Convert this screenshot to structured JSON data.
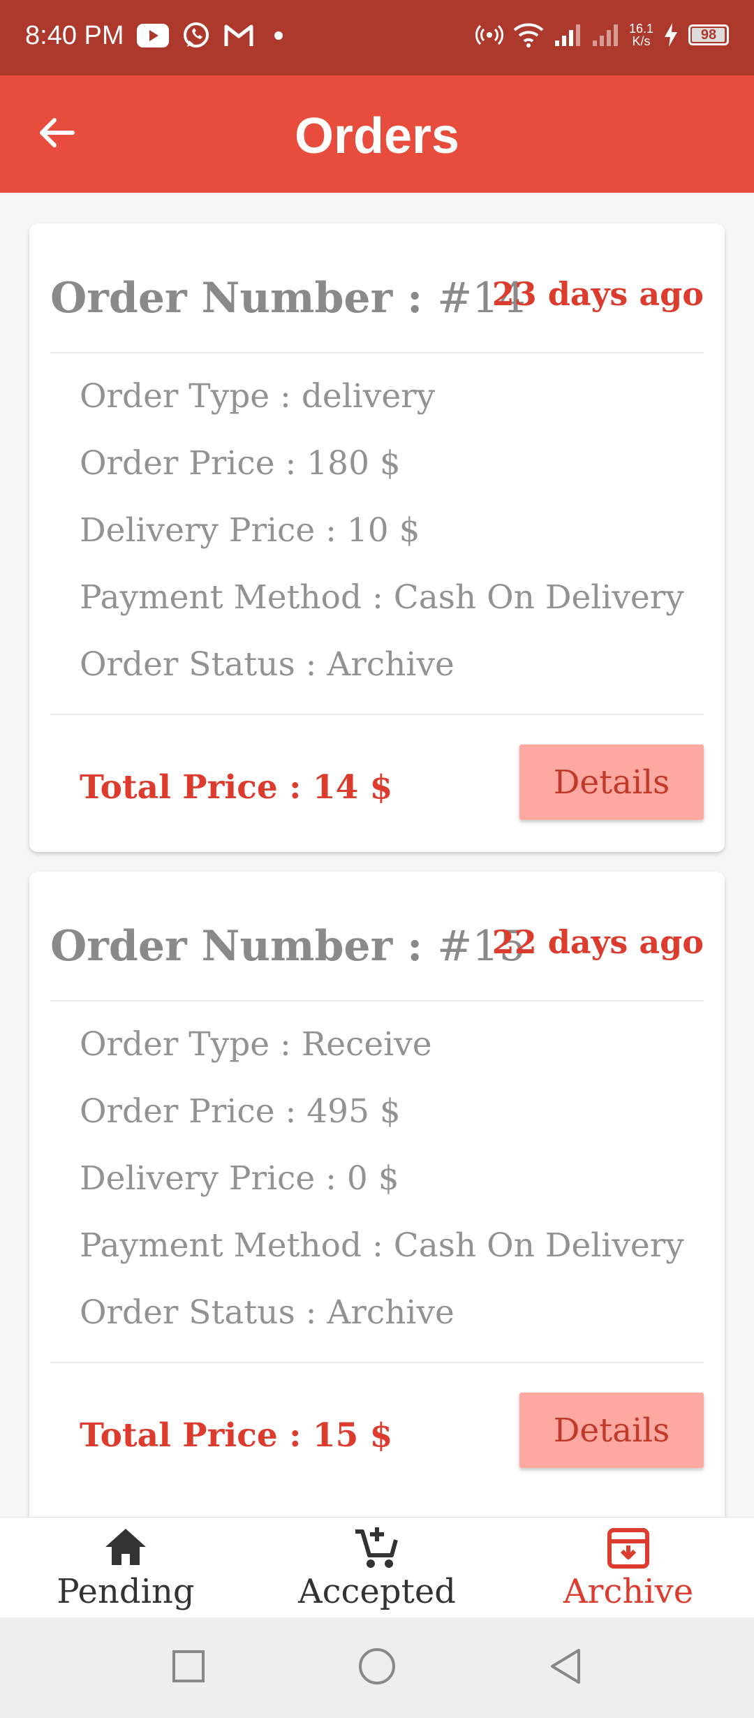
{
  "status_bar": {
    "time": "8:40 PM",
    "net_speed_value": "16.1",
    "net_speed_unit": "K/s",
    "battery": "98",
    "battery_level": 0.98,
    "icons": [
      "youtube-icon",
      "whatsapp-icon",
      "gmail-icon",
      "dot-icon",
      "hotspot-icon",
      "wifi-icon",
      "signal-icon",
      "signal-icon-2",
      "charging-icon",
      "battery-icon"
    ]
  },
  "app_bar": {
    "title": "Orders",
    "back_icon": "arrow-left-icon"
  },
  "orders": [
    {
      "number_label": "Order Number :",
      "number": "#14",
      "time_ago": "23 days ago",
      "order_type": "Order Type : delivery",
      "order_price": "Order Price : 180 $",
      "delivery_price": "Delivery Price : 10 $",
      "payment_method": "Payment Method : Cash On Delivery",
      "status": "Order Status : Archive",
      "total": "Total Price : 14 $",
      "details_label": "Details"
    },
    {
      "number_label": "Order Number :",
      "number": "#15",
      "time_ago": "22 days ago",
      "order_type": "Order Type : Receive",
      "order_price": "Order Price : 495 $",
      "delivery_price": "Delivery Price : 0 $",
      "payment_method": "Payment Method : Cash On Delivery",
      "status": "Order Status : Archive",
      "total": "Total Price : 15 $",
      "details_label": "Details"
    }
  ],
  "bottom_nav": {
    "items": [
      {
        "label": "Pending",
        "icon": "home-icon",
        "active": false
      },
      {
        "label": "Accepted",
        "icon": "cart-add-icon",
        "active": false
      },
      {
        "label": "Archive",
        "icon": "archive-icon",
        "active": true
      }
    ]
  },
  "colors": {
    "status_bar": "#ad382c",
    "app_bar": "#e74c3c",
    "accent_text": "#dc3c2e",
    "details_button": "#fda8a0",
    "muted_text": "#929292"
  }
}
